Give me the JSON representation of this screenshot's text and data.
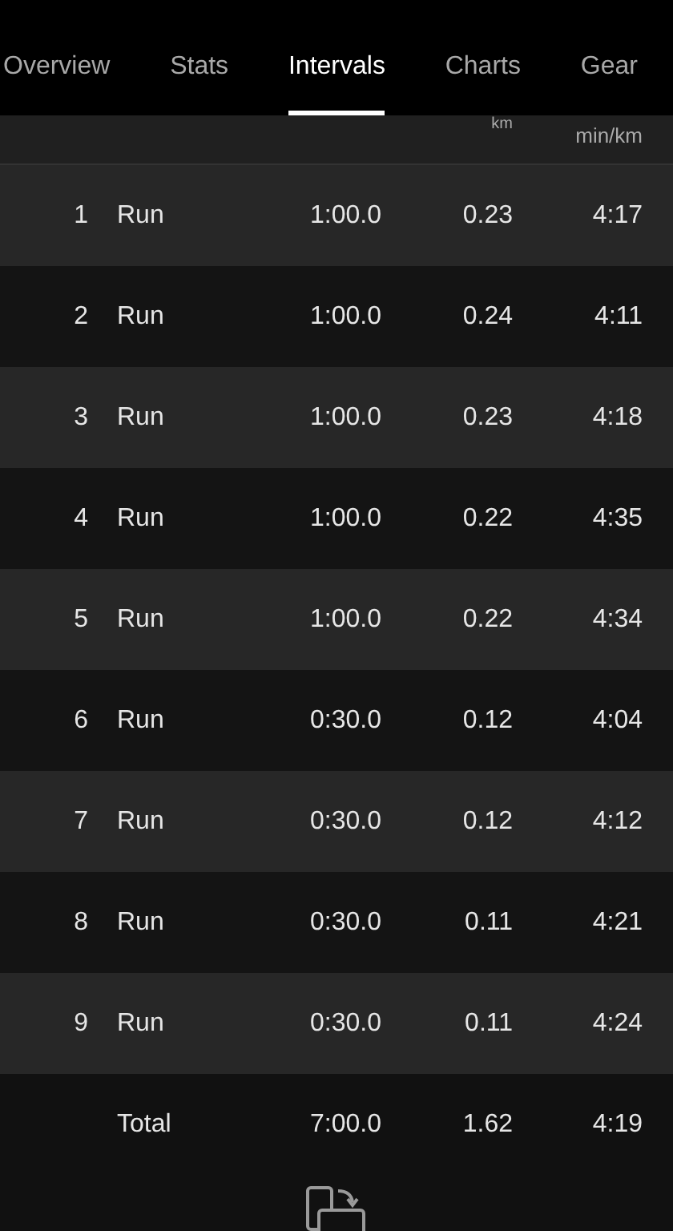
{
  "tabs": [
    {
      "label": "Overview",
      "selected": false
    },
    {
      "label": "Stats",
      "selected": false
    },
    {
      "label": "Intervals",
      "selected": true
    },
    {
      "label": "Charts",
      "selected": false
    },
    {
      "label": "Gear",
      "selected": false
    }
  ],
  "table": {
    "header": {
      "distance_unit": "km",
      "pace_unit": "min/km"
    },
    "rows": [
      {
        "index": "1",
        "type": "Run",
        "time": "1:00.0",
        "distance": "0.23",
        "pace": "4:17"
      },
      {
        "index": "2",
        "type": "Run",
        "time": "1:00.0",
        "distance": "0.24",
        "pace": "4:11"
      },
      {
        "index": "3",
        "type": "Run",
        "time": "1:00.0",
        "distance": "0.23",
        "pace": "4:18"
      },
      {
        "index": "4",
        "type": "Run",
        "time": "1:00.0",
        "distance": "0.22",
        "pace": "4:35"
      },
      {
        "index": "5",
        "type": "Run",
        "time": "1:00.0",
        "distance": "0.22",
        "pace": "4:34"
      },
      {
        "index": "6",
        "type": "Run",
        "time": "0:30.0",
        "distance": "0.12",
        "pace": "4:04"
      },
      {
        "index": "7",
        "type": "Run",
        "time": "0:30.0",
        "distance": "0.12",
        "pace": "4:12"
      },
      {
        "index": "8",
        "type": "Run",
        "time": "0:30.0",
        "distance": "0.11",
        "pace": "4:21"
      },
      {
        "index": "9",
        "type": "Run",
        "time": "0:30.0",
        "distance": "0.11",
        "pace": "4:24"
      }
    ],
    "total": {
      "label": "Total",
      "time": "7:00.0",
      "distance": "1.62",
      "pace": "4:19"
    }
  }
}
